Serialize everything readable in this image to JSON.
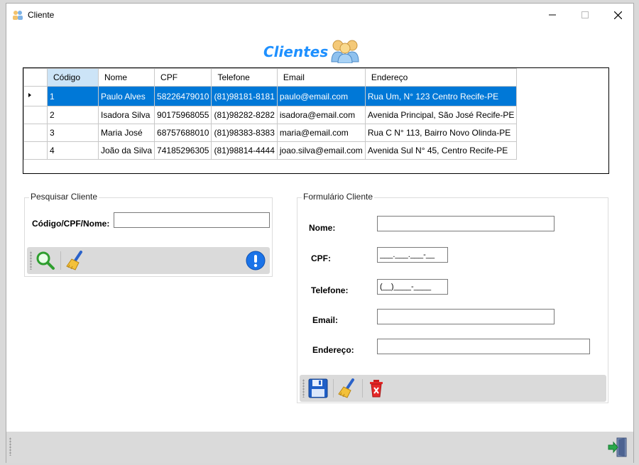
{
  "window": {
    "title": "Cliente"
  },
  "heading": "Clientes",
  "grid": {
    "columns": [
      "Código",
      "Nome",
      "CPF",
      "Telefone",
      "Email",
      "Endereço"
    ],
    "rows": [
      [
        "1",
        "Paulo Alves",
        "58226479010",
        "(81)98181-8181",
        "paulo@email.com",
        "Rua Um, N° 123 Centro Recife-PE"
      ],
      [
        "2",
        "Isadora Silva",
        "90175968055",
        "(81)98282-8282",
        "isadora@email.com",
        "Avenida Principal, São José Recife-PE"
      ],
      [
        "3",
        "Maria José",
        "68757688010",
        "(81)98383-8383",
        "maria@email.com",
        "Rua C N° 113, Bairro Novo Olinda-PE"
      ],
      [
        "4",
        "João da Silva",
        "74185296305",
        "(81)98814-4444",
        "joao.silva@email.com",
        "Avenida Sul N° 45, Centro Recife-PE"
      ]
    ],
    "selected_row": 0
  },
  "search": {
    "group_title": "Pesquisar Cliente",
    "label": "Código/CPF/Nome:",
    "value": ""
  },
  "form": {
    "group_title": "Formulário Cliente",
    "nome_label": "Nome:",
    "nome_value": "",
    "cpf_label": "CPF:",
    "cpf_mask": "___.___.___-__",
    "telefone_label": "Telefone:",
    "telefone_mask": "(__)____-____",
    "email_label": "Email:",
    "email_value": "",
    "endereco_label": "Endereço:",
    "endereco_value": ""
  },
  "icons": {
    "search": "search-icon",
    "clear": "broom-icon",
    "info": "info-icon",
    "save": "save-icon",
    "delete": "trash-icon",
    "exit": "exit-icon"
  },
  "colors": {
    "accent": "#1e90ff",
    "selection": "#0078d7"
  }
}
